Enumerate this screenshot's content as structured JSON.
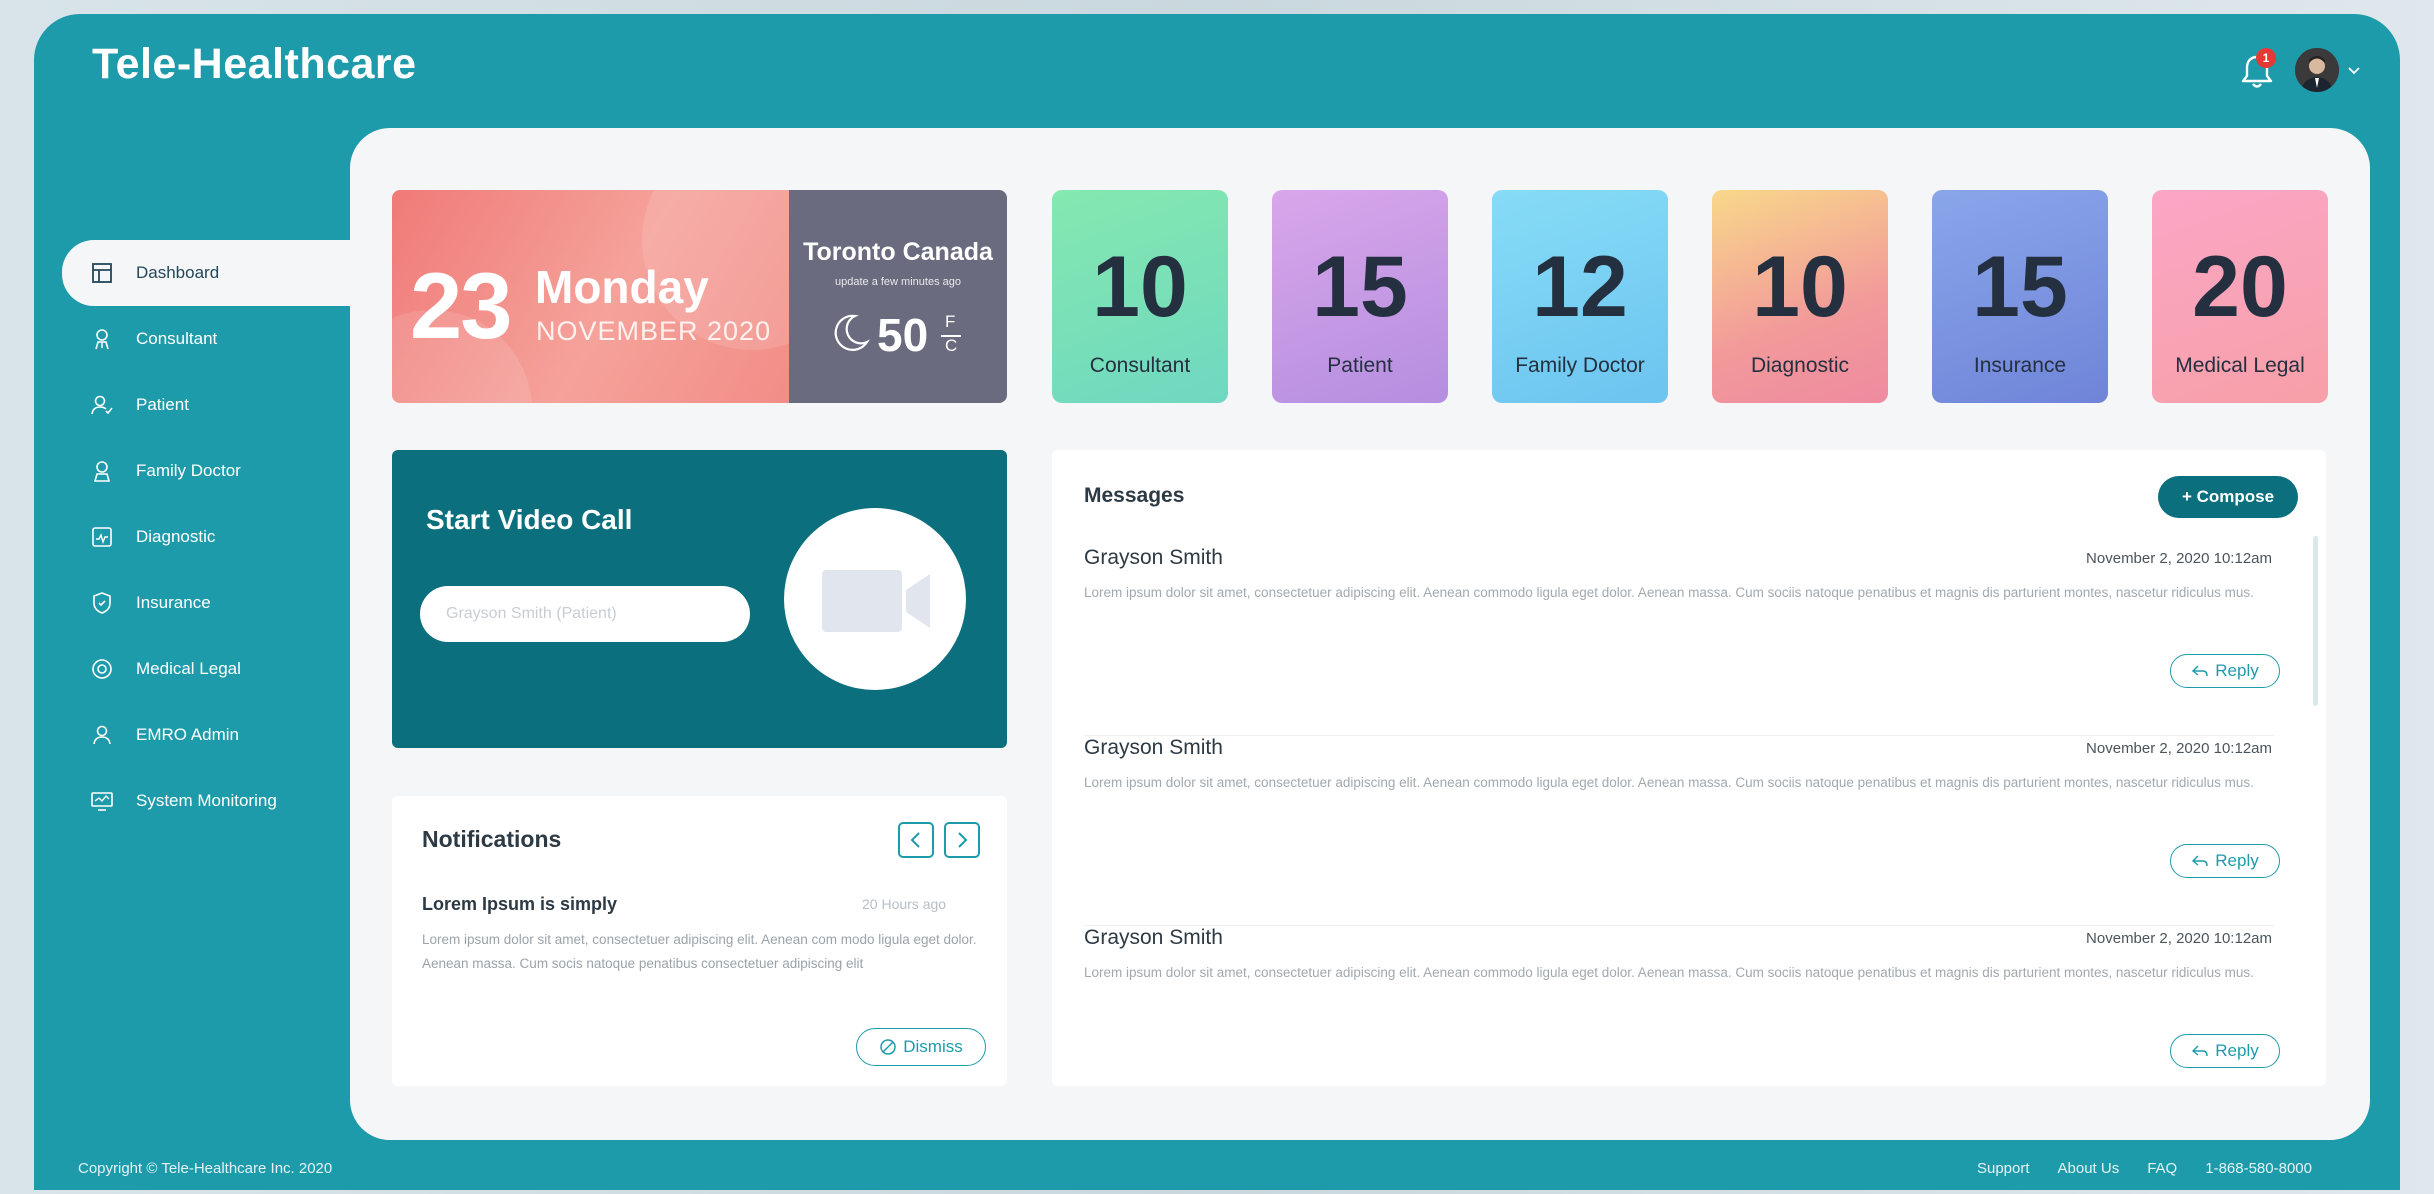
{
  "app": {
    "title": "Tele-Healthcare",
    "accent": "#1e9bab",
    "dark_accent": "#0b6f7e"
  },
  "header": {
    "notification_count": "1"
  },
  "sidebar": {
    "items": [
      {
        "label": "Dashboard",
        "icon": "dashboard-icon",
        "active": true
      },
      {
        "label": "Consultant",
        "icon": "consultant-icon"
      },
      {
        "label": "Patient",
        "icon": "patient-icon"
      },
      {
        "label": "Family Doctor",
        "icon": "family-doctor-icon"
      },
      {
        "label": "Diagnostic",
        "icon": "diagnostic-icon"
      },
      {
        "label": "Insurance",
        "icon": "insurance-icon"
      },
      {
        "label": "Medical Legal",
        "icon": "medical-legal-icon"
      },
      {
        "label": "EMRO Admin",
        "icon": "admin-icon"
      },
      {
        "label": "System Monitoring",
        "icon": "monitoring-icon"
      }
    ]
  },
  "date_card": {
    "day_number": "23",
    "weekday": "Monday",
    "month_year": "NOVEMBER 2020",
    "city": "Toronto Canada",
    "updated": "update a few minutes ago",
    "temperature": "50",
    "unit_f": "F",
    "unit_c": "C"
  },
  "stats": [
    {
      "value": "10",
      "label": "Consultant",
      "color": "#7fe6b5"
    },
    {
      "value": "15",
      "label": "Patient",
      "color": "#c99ee6"
    },
    {
      "value": "12",
      "label": "Family Doctor",
      "color": "#7cd4f3"
    },
    {
      "value": "10",
      "label": "Diagnostic",
      "color": "#f4a594"
    },
    {
      "value": "15",
      "label": "Insurance",
      "color": "#7f98e2"
    },
    {
      "value": "20",
      "label": "Medical Legal",
      "color": "#f8a2b8"
    }
  ],
  "video_call": {
    "title": "Start Video Call",
    "input_placeholder": "Grayson Smith (Patient)"
  },
  "notifications": {
    "title": "Notifications",
    "item": {
      "heading": "Lorem Ipsum is simply",
      "time": "20 Hours ago",
      "body": "Lorem ipsum dolor sit amet, consectetuer adipiscing elit. Aenean com modo ligula eget dolor. Aenean massa. Cum socis natoque penatibus consectetuer adipiscing elit",
      "dismiss_label": "Dismiss"
    }
  },
  "messages": {
    "title": "Messages",
    "compose_label": "+ Compose",
    "items": [
      {
        "sender": "Grayson Smith",
        "time": "November 2, 2020 10:12am",
        "text": "Lorem ipsum dolor sit amet, consectetuer adipiscing elit. Aenean commodo ligula eget dolor. Aenean massa. Cum sociis natoque penatibus et magnis dis parturient montes, nascetur ridiculus mus.",
        "reply_label": "Reply"
      },
      {
        "sender": "Grayson Smith",
        "time": "November 2, 2020 10:12am",
        "text": "Lorem ipsum dolor sit amet, consectetuer adipiscing elit. Aenean commodo ligula eget dolor. Aenean massa. Cum sociis natoque penatibus et magnis dis parturient montes, nascetur ridiculus mus.",
        "reply_label": "Reply"
      },
      {
        "sender": "Grayson Smith",
        "time": "November 2, 2020 10:12am",
        "text": "Lorem ipsum dolor sit amet, consectetuer adipiscing elit. Aenean commodo ligula eget dolor. Aenean massa. Cum sociis natoque penatibus et magnis dis parturient montes, nascetur ridiculus mus.",
        "reply_label": "Reply"
      }
    ]
  },
  "footer": {
    "copyright": "Copyright © Tele-Healthcare Inc. 2020",
    "links": [
      "Support",
      "About Us",
      "FAQ",
      "1-868-580-8000"
    ]
  }
}
